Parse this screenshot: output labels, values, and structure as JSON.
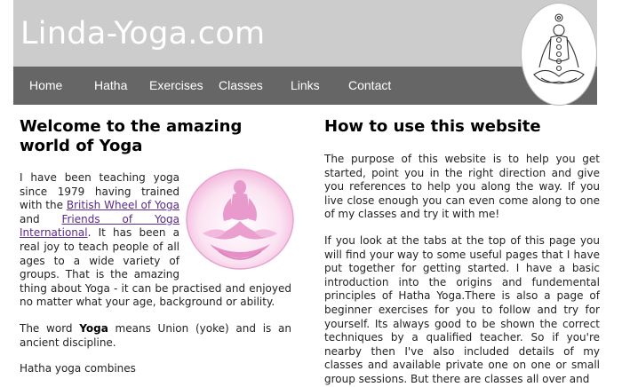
{
  "site": {
    "title": "Linda-Yoga.com"
  },
  "nav": {
    "items": [
      {
        "label": "Home"
      },
      {
        "label": "Hatha"
      },
      {
        "label": "Exercises"
      },
      {
        "label": "Classes"
      },
      {
        "label": "Links"
      },
      {
        "label": "Contact"
      }
    ]
  },
  "left": {
    "heading": "Welcome to the amazing world of Yoga",
    "p1": {
      "before": "I have been teaching yoga since 1979 having trained with the ",
      "link1": "British Wheel of Yoga",
      "mid": " and ",
      "link2": "Friends of Yoga International",
      "after": ". It has been a real joy to teach people of all ages to a wide variety of groups. That is the amazing thing about Yoga - it can be practised and enjoyed no matter what your age, background or ability."
    },
    "p2": {
      "before": "The word ",
      "bold": "Yoga",
      "after": " means Union (yoke) and is an ancient discipline."
    },
    "p3": "Hatha yoga combines"
  },
  "right": {
    "heading": "How to use this website",
    "p1": "The purpose of this website is to help you get started, point you in the right direction and give you references to help you along the way. If you live close enough you can even come along to one of my classes and try it with me!",
    "p2": "If you look at the tabs at the top of this page you will find your way to some useful pages that I have put together for getting started. I have a basic introduction into the origins and fundemental principles of Hatha Yoga.There is also a page of beginner exercises for you to follow and try for yourself. Its always good to be shown the correct techniques by a qualified teacher. So if you're nearby then I've also included details of my classes and available private one on one or small group sessions. But there are classes all over and"
  },
  "colors": {
    "header_bg": "#cccccc",
    "nav_bg": "#666666",
    "link": "#5b2a8a",
    "meditation_pink": "#e79acb"
  },
  "icons": {
    "logo": "chakra-meditation-figure-icon",
    "illustration": "pink-meditating-buddha-icon"
  }
}
